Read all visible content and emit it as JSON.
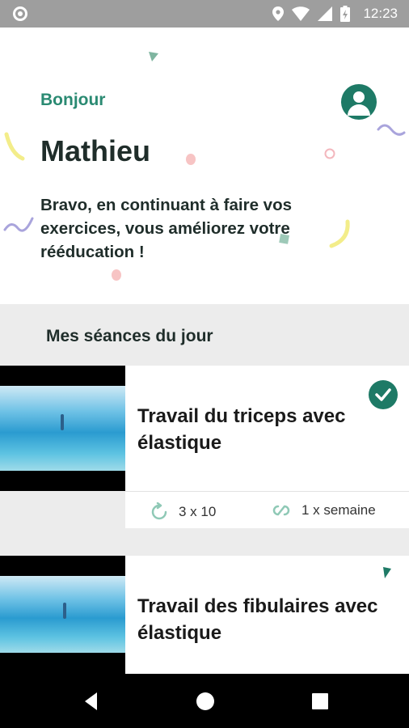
{
  "status_bar": {
    "time": "12:23",
    "icons": [
      "location-icon",
      "wifi-icon",
      "signal-icon",
      "battery-icon"
    ]
  },
  "header": {
    "greeting": "Bonjour",
    "name": "Mathieu",
    "message": "Bravo, en continuant à faire vos exercices, vous améliorez votre rééducation !",
    "avatar_icon": "account-icon"
  },
  "section": {
    "title": "Mes séances du jour"
  },
  "sessions": [
    {
      "title": "Travail du triceps avec élastique",
      "completed": true,
      "reps": "3 x 10",
      "frequency": "1 x semaine"
    },
    {
      "title": "Travail des fibulaires avec élastique",
      "completed": false
    }
  ],
  "colors": {
    "accent": "#1e7a66",
    "greeting": "#2a8a72",
    "text_dark": "#1f2d2a",
    "section_bg": "#ececec",
    "status_bar": "#9e9e9e"
  },
  "nav_bar": {
    "icons": [
      "back-icon",
      "home-icon",
      "recent-apps-icon"
    ]
  }
}
